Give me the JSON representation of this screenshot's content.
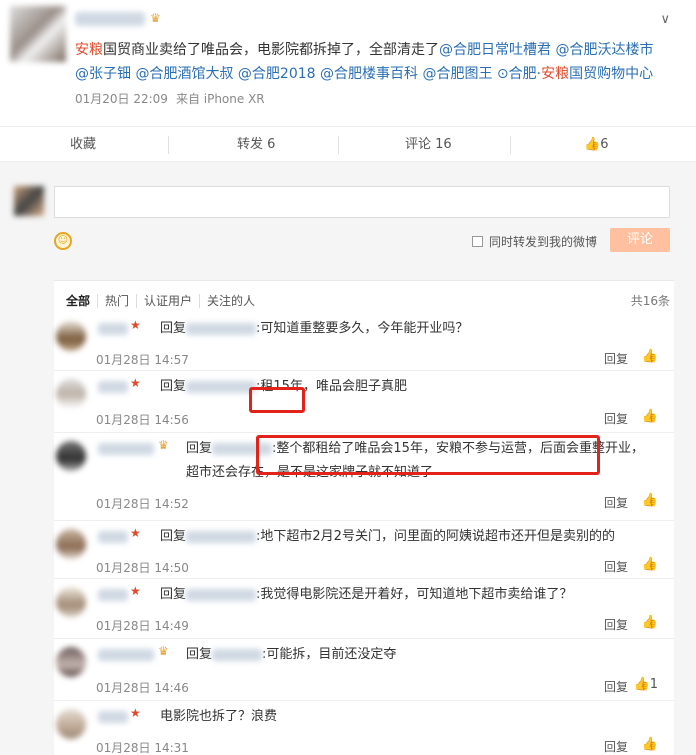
{
  "post": {
    "text_prefix": "安粮",
    "text_1": "国贸商业卖给了唯品会，电影院都拆掉了，全部清走了",
    "mentions": [
      "@合肥日常吐槽君",
      "@合肥沃达楼市",
      "@张子钿",
      "@合肥酒馆大叔",
      "@合肥2018",
      "@合肥楼事百科",
      "@合肥图王"
    ],
    "location": "合肥·安粮国贸购物中心",
    "location_red": "安粮",
    "date": "01月20日 22:09",
    "source": "来自 iPhone XR"
  },
  "actions": {
    "favorite": "收藏",
    "repost": "转发 6",
    "comment": "评论 16",
    "like": "6"
  },
  "composer": {
    "checkbox_label": "同时转发到我的微博",
    "submit": "评论"
  },
  "filters": {
    "all": "全部",
    "hot": "热门",
    "verified": "认证用户",
    "following": "关注的人",
    "total": "共16条"
  },
  "comments": [
    {
      "reply": "回复",
      "text": ":可知道重整要多久，今年能开业吗？",
      "time": "01月28日 14:57",
      "reply_label": "回复",
      "likes": ""
    },
    {
      "reply": "回复",
      "text": ":租15年，唯品会胆子真肥",
      "time": "01月28日 14:56",
      "reply_label": "回复",
      "likes": ""
    },
    {
      "reply": "回复",
      "text": ":整个都租给了唯品会15年，安粮不参与运营，后面会重整开业，超市还会存在，是不是这家牌子就不知道了",
      "time": "01月28日 14:52",
      "reply_label": "回复",
      "likes": ""
    },
    {
      "reply": "回复",
      "text": ":地下超市2月2号关门，问里面的阿姨说超市还开但是卖别的的",
      "time": "01月28日 14:50",
      "reply_label": "回复",
      "likes": ""
    },
    {
      "reply": "回复",
      "text": ":我觉得电影院还是开着好，可知道地下超市卖给谁了？",
      "time": "01月28日 14:49",
      "reply_label": "回复",
      "likes": ""
    },
    {
      "reply": "回复",
      "text": ":可能拆，目前还没定夺",
      "time": "01月28日 14:46",
      "reply_label": "回复",
      "likes": "1"
    },
    {
      "reply": "",
      "text": "电影院也拆了？浪费",
      "time": "01月28日 14:31",
      "reply_label": "回复",
      "likes": ""
    }
  ]
}
